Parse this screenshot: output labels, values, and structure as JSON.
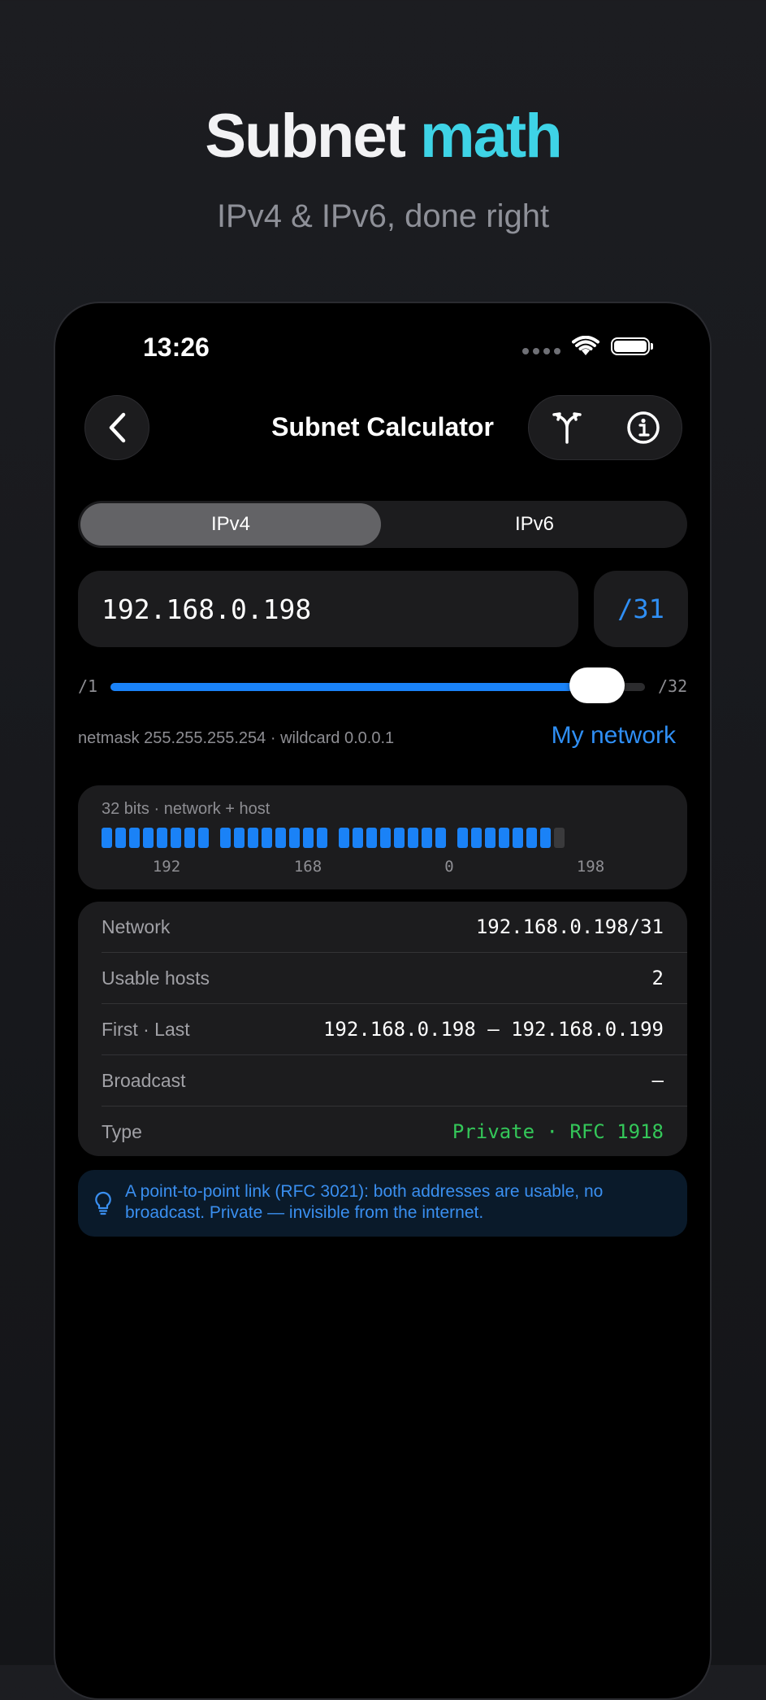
{
  "promo": {
    "title_part1": "Subnet",
    "title_part2": "math",
    "subtitle": "IPv4 & IPv6, done right"
  },
  "status_bar": {
    "time": "13:26"
  },
  "nav": {
    "title": "Subnet Calculator",
    "back_icon": "chevron-left-icon",
    "fork_icon": "fork-icon",
    "info_icon": "info-icon"
  },
  "segment": {
    "options": [
      "IPv4",
      "IPv6"
    ],
    "selected": "IPv4"
  },
  "input": {
    "address": "192.168.0.198",
    "prefix": "/31"
  },
  "slider": {
    "min_label": "/1",
    "max_label": "/32",
    "min": 1,
    "max": 32,
    "value": 31
  },
  "netmask_text": "netmask 255.255.255.254 · wildcard 0.0.0.1",
  "my_network_link": "My network",
  "bits": {
    "label": "32 bits · network + host",
    "network_bits": 31,
    "octets": [
      "192",
      "168",
      "0",
      "198"
    ]
  },
  "info": [
    {
      "label": "Network",
      "value": "192.168.0.198/31"
    },
    {
      "label": "Usable hosts",
      "value": "2"
    },
    {
      "label": "First · Last",
      "value": "192.168.0.198 – 192.168.0.199"
    },
    {
      "label": "Broadcast",
      "value": "—"
    },
    {
      "label": "Type",
      "value": "Private · RFC 1918"
    }
  ],
  "tip": {
    "icon": "lightbulb-icon",
    "text": "A point-to-point link (RFC 3021): both addresses are usable, no broadcast. Private — invisible from the internet."
  },
  "colors": {
    "accent": "#1a82f7",
    "highlight": "#3ed3e6",
    "private_green": "#34c759"
  }
}
